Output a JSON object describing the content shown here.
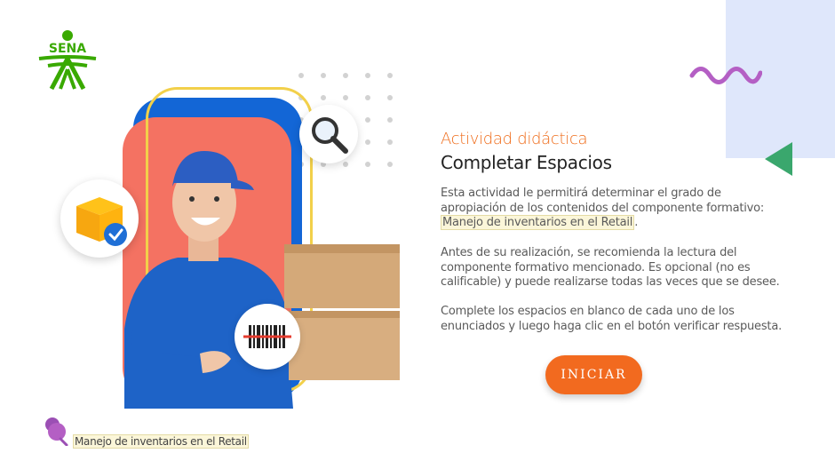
{
  "brand": {
    "logo_text": "SENA",
    "color": "#39a900"
  },
  "content": {
    "subtitle": "Actividad didáctica",
    "title": "Completar Espacios",
    "paragraph1_prefix": "Esta actividad le permitirá determinar el grado de apropiación de los contenidos del componente formativo: ",
    "paragraph1_highlight": "Manejo de inventarios en el Retail",
    "paragraph1_suffix": ".",
    "paragraph2": "Antes de su realización, se recomienda la lectura del componente formativo mencionado. Es opcional (no es calificable) y puede realizarse todas las veces que se desee.",
    "paragraph3": "Complete los espacios en blanco de cada uno de los enunciados y luego haga clic en el botón verificar respuesta."
  },
  "actions": {
    "start_label": "INICIAR"
  },
  "footer": {
    "course_label": "Manejo de inventarios en el Retail"
  },
  "colors": {
    "accent_orange": "#f26a1f",
    "subtitle_orange": "#ef6c1a",
    "deco_blue": "#dfe7fb",
    "deco_green": "#3aa76d",
    "deco_purple": "#b45fc4",
    "card_blue": "#1366d6",
    "card_coral": "#f47262",
    "frame_yellow": "#f2d04a"
  },
  "icons": [
    "sena-logo",
    "search-icon",
    "box-check-icon",
    "barcode-icon",
    "pin-icon",
    "wave-decoration",
    "triangle-decoration"
  ]
}
